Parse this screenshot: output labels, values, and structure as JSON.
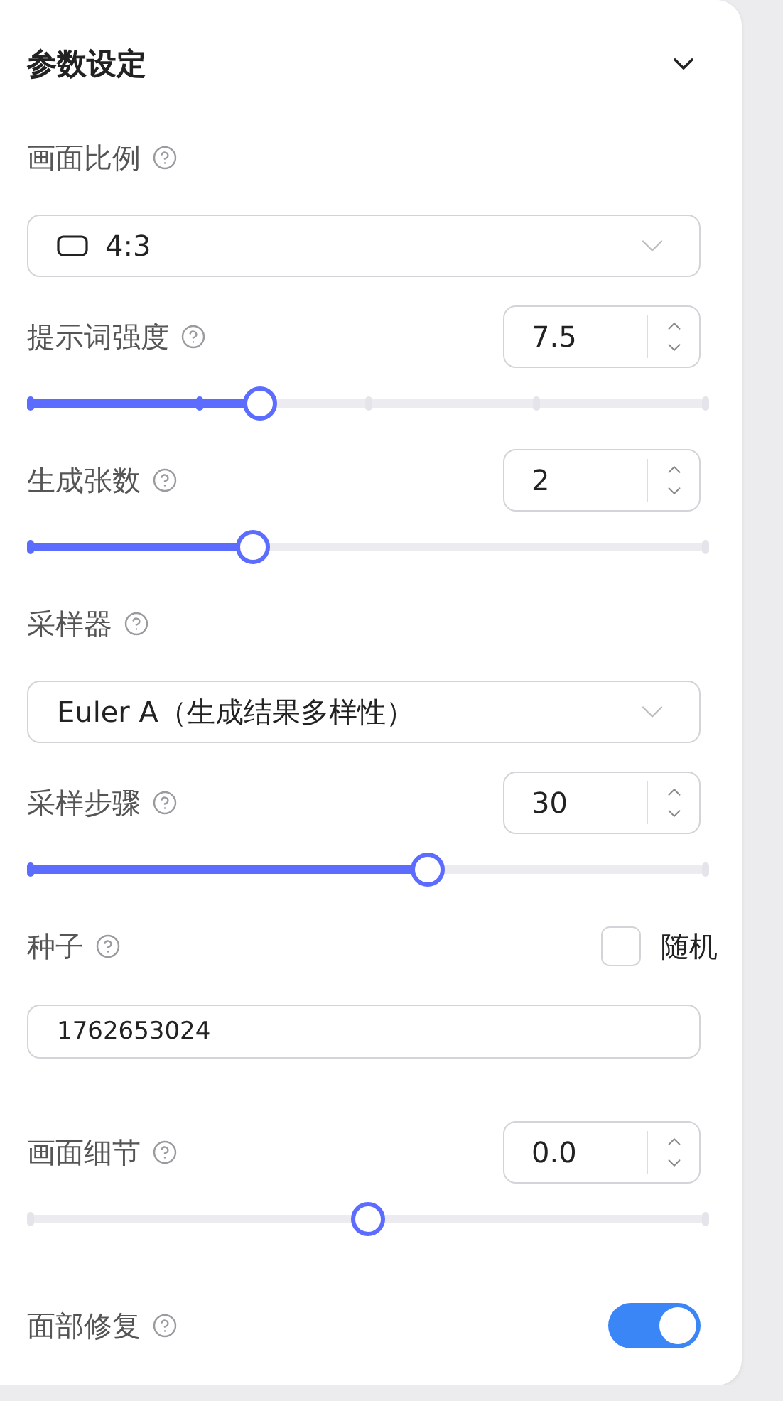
{
  "panel": {
    "title": "参数设定",
    "expanded": true
  },
  "items": [
    {
      "kind": "select",
      "label": "画面比例",
      "value": "4:3",
      "shape_icon": true
    },
    {
      "kind": "number_slider",
      "label": "提示词强度",
      "value": "7.5",
      "slider": {
        "kind": "steps",
        "level": 0.34
      }
    },
    {
      "kind": "number_slider",
      "label": "生成张数",
      "value": "2",
      "slider": {
        "kind": "range",
        "level": 0.33
      }
    },
    {
      "kind": "select",
      "label": "采样器",
      "value": "Euler A（生成结果多样性）",
      "shape_icon": false
    },
    {
      "kind": "number_slider",
      "label": "采样步骤",
      "value": "30",
      "slider": {
        "kind": "range",
        "level": 0.59
      }
    },
    {
      "kind": "seed",
      "label": "种子",
      "checkbox_label": "随机",
      "checked": false,
      "value": "1762653024"
    },
    {
      "kind": "number_slider",
      "label": "画面细节",
      "value": "0.0",
      "slider": {
        "kind": "centered",
        "level": 0.5
      }
    },
    {
      "kind": "toggle",
      "label": "面部修复",
      "on": true
    }
  ]
}
